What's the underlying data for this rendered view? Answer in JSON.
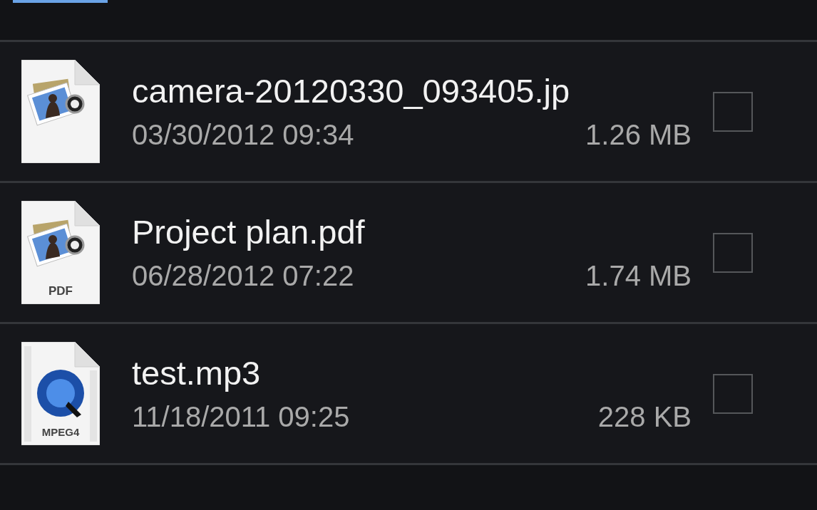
{
  "files": [
    {
      "kind": "image",
      "name": "camera-20120330_093405.jp",
      "date": "03/30/2012 09:34",
      "size": "1.26 MB",
      "checked": false
    },
    {
      "kind": "pdf",
      "badge": "PDF",
      "name": "Project plan.pdf",
      "date": "06/28/2012 07:22",
      "size": "1.74 MB",
      "checked": false
    },
    {
      "kind": "video",
      "badge": "MPEG4",
      "name": "test.mp3",
      "date": "11/18/2011 09:25",
      "size": "228 KB",
      "checked": false
    }
  ]
}
